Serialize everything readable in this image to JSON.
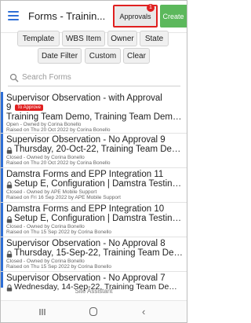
{
  "header": {
    "title": "Forms - Trainin...",
    "approvals_label": "Approvals",
    "approvals_badge": "1",
    "create_label": "Create"
  },
  "filters": {
    "row1": [
      "Template",
      "WBS Item",
      "Owner",
      "State"
    ],
    "row2": [
      "Date Filter",
      "Custom",
      "Clear"
    ]
  },
  "search": {
    "placeholder": "Search Forms"
  },
  "items": [
    {
      "title": "Supervisor Observation - with Approval",
      "title2": "9",
      "tag": "To Approve",
      "subtitle": "Training Team Demo, Training Team Demo, C...",
      "status": "Open - Owned by Corina Bonello",
      "raised": "Raised on Thu 20 Oct 2022 by Corina Bonello",
      "locked": false
    },
    {
      "title": "Supervisor Observation - No Approval 9",
      "subtitle": "Thursday, 20-Oct-22, Training Team Demo, ...",
      "status": "Closed - Owned by Corina Bonello",
      "raised": "Raised on Thu 20 Oct 2022 by Corina Bonello",
      "locked": true
    },
    {
      "title": "Damstra Forms and EPP Integration 11",
      "subtitle": "Setup E, Configuration | Damstra Testing Co...",
      "status": "Closed - Owned by APE Mobile Support",
      "raised": "Raised on Fri 16 Sep 2022 by APE Mobile Support",
      "locked": true
    },
    {
      "title": "Damstra Forms and EPP Integration 10",
      "subtitle": "Setup E, Configuration | Damstra Testing Co...",
      "status": "Closed - Owned by Corina Bonello",
      "raised": "Raised on Thu 15 Sep 2022 by Corina Bonello",
      "locked": true
    },
    {
      "title": "Supervisor Observation - No Approval 8",
      "subtitle": "Thursday, 15-Sep-22, Training Team Demo, ...",
      "status": "Closed - Owned by Corina Bonello",
      "raised": "Raised on Thu 15 Sep 2022 by Corina Bonello",
      "locked": true
    },
    {
      "title": "Supervisor Observation - No Approval 7",
      "subtitle": "Wednesday, 14-Sep-22, Training Team Demo,...",
      "locked": true
    }
  ],
  "footer": {
    "site_assistant": "Site Assistant"
  },
  "colors": {
    "accent": "#2f6fd6",
    "create": "#5cb85c",
    "alert": "#e02020"
  }
}
